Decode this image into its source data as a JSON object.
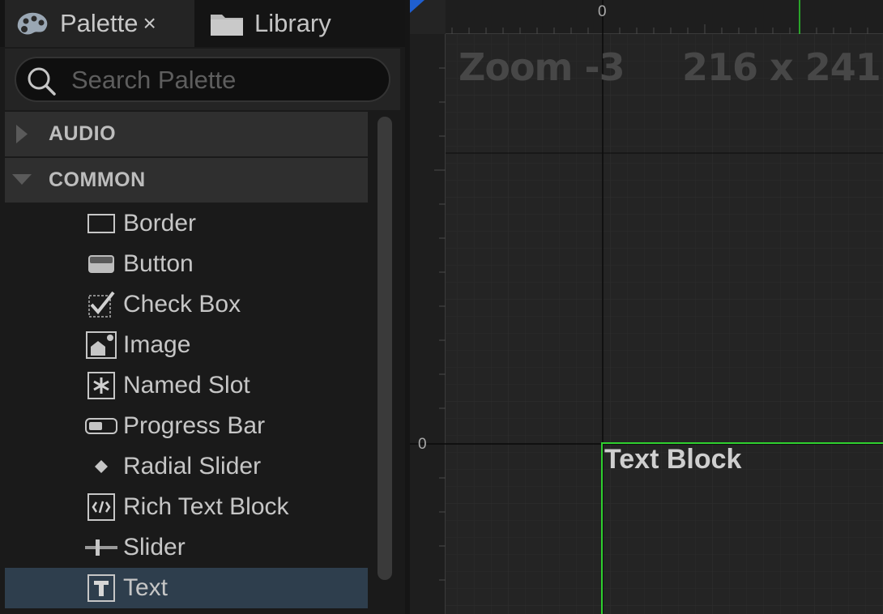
{
  "tabs": {
    "palette": {
      "label": "Palette",
      "close": "×",
      "icon": "palette-icon"
    },
    "library": {
      "label": "Library",
      "icon": "folder-icon"
    }
  },
  "search": {
    "placeholder": "Search Palette",
    "value": ""
  },
  "categories": [
    {
      "label": "AUDIO",
      "expanded": false
    },
    {
      "label": "COMMON",
      "expanded": true
    }
  ],
  "items": [
    {
      "label": "Border",
      "icon": "border-icon"
    },
    {
      "label": "Button",
      "icon": "button-icon"
    },
    {
      "label": "Check Box",
      "icon": "checkbox-icon"
    },
    {
      "label": "Image",
      "icon": "image-icon"
    },
    {
      "label": "Named Slot",
      "icon": "named-slot-icon"
    },
    {
      "label": "Progress Bar",
      "icon": "progress-bar-icon"
    },
    {
      "label": "Radial Slider",
      "icon": "radial-slider-icon"
    },
    {
      "label": "Rich Text Block",
      "icon": "rich-text-icon"
    },
    {
      "label": "Slider",
      "icon": "slider-icon"
    },
    {
      "label": "Text",
      "icon": "text-icon",
      "selected": true
    }
  ],
  "viewport": {
    "zoom_label": "Zoom -3",
    "size_label": "216 x 241",
    "ruler_top_origin": "0",
    "ruler_left_origin": "0",
    "widget_label": "Text Block"
  },
  "colors": {
    "selection": "#2e3e4d",
    "widget_outline": "#2fd02f",
    "corner_accent": "#1f5fd0"
  }
}
